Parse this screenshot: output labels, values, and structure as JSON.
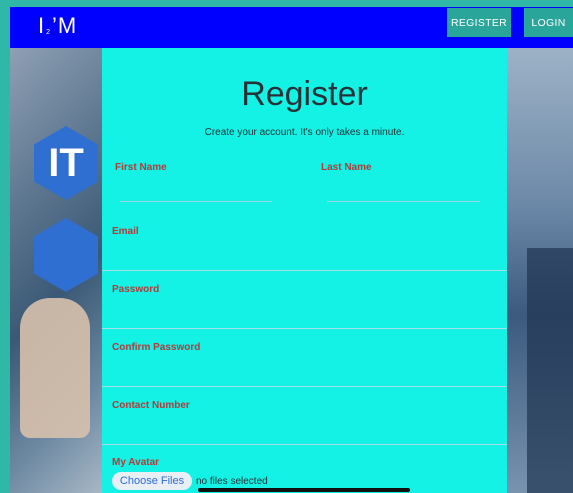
{
  "navbar": {
    "logo_main": "I",
    "logo_sub": "2",
    "logo_rest": "’M",
    "register_label": "REGISTER",
    "login_label": "LOGIN"
  },
  "background": {
    "left_badge": "IT"
  },
  "form": {
    "title": "Register",
    "subtitle": "Create your account. It's only takes a minute.",
    "first_name_label": "First Name",
    "first_name_value": "",
    "last_name_label": "Last Name",
    "last_name_value": "",
    "email_label": "Email",
    "email_value": "",
    "password_label": "Password",
    "password_value": "",
    "confirm_password_label": "Confirm Password",
    "confirm_password_value": "",
    "contact_label": "Contact Number",
    "contact_value": "",
    "avatar_label": "My Avatar",
    "choose_files_label": "Choose Files",
    "no_files_text": "no files selected"
  },
  "colors": {
    "navbar": "#0000ff",
    "form_background": "#13f2e4",
    "label": "#b53939",
    "button": "#2aa59a"
  }
}
